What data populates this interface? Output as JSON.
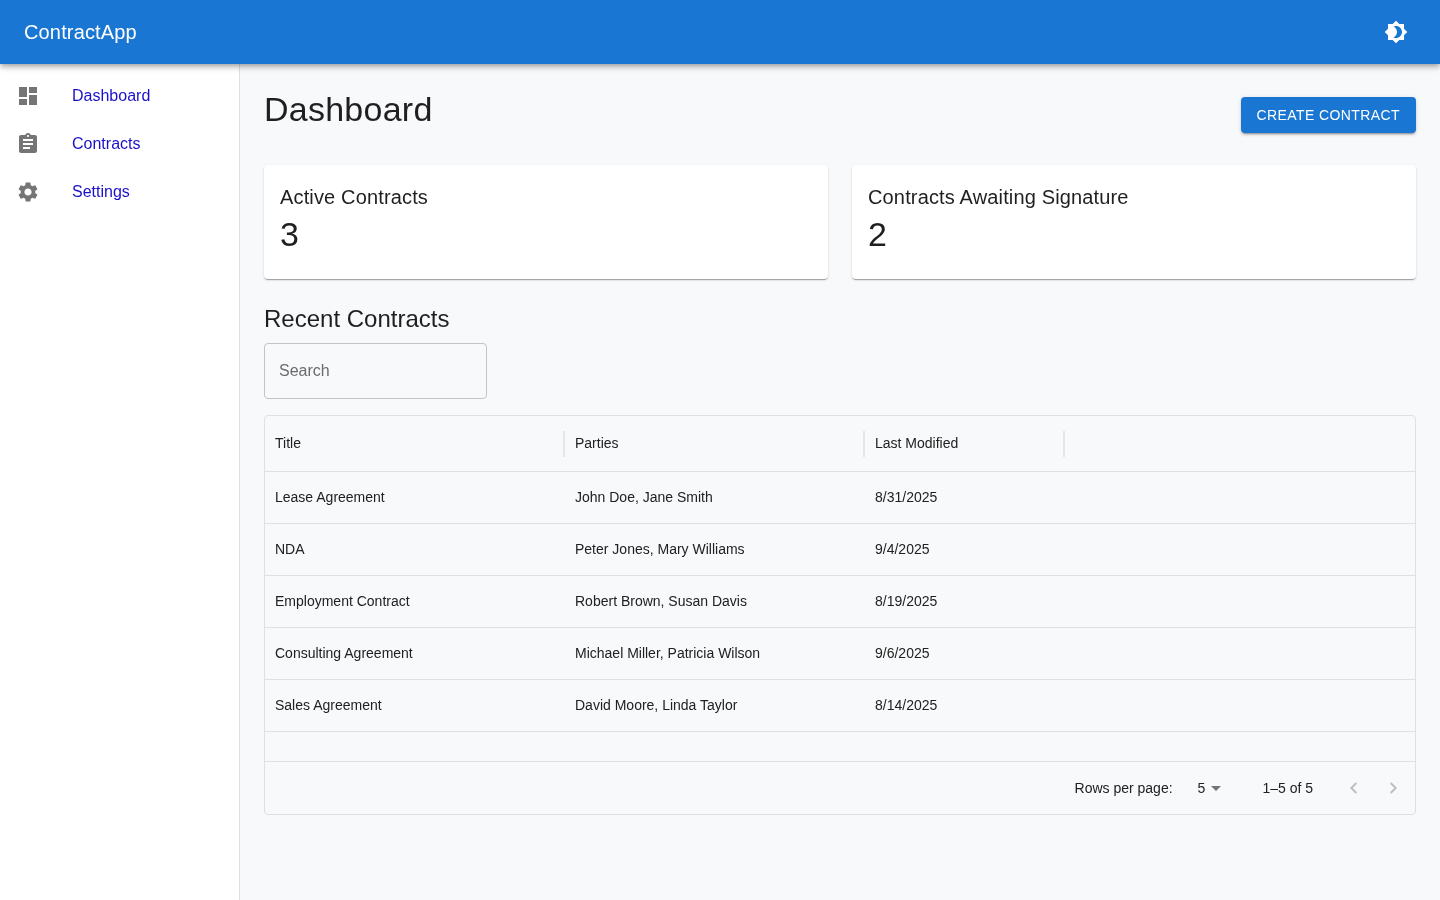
{
  "app_bar": {
    "title": "ContractApp"
  },
  "sidebar": {
    "items": [
      {
        "label": "Dashboard"
      },
      {
        "label": "Contracts"
      },
      {
        "label": "Settings"
      }
    ]
  },
  "page": {
    "title": "Dashboard",
    "primary_button": "CREATE CONTRACT"
  },
  "stat_cards": [
    {
      "label": "Active Contracts",
      "value": "3"
    },
    {
      "label": "Contracts Awaiting Signature",
      "value": "2"
    }
  ],
  "recent_contracts": {
    "title": "Recent Contracts",
    "search": {
      "placeholder": "Search"
    },
    "table": {
      "columns": [
        "Title",
        "Parties",
        "Last Modified"
      ],
      "rows": [
        [
          "Lease Agreement",
          "John Doe, Jane Smith",
          "8/31/2025"
        ],
        [
          "NDA",
          "Peter Jones, Mary Williams",
          "9/4/2025"
        ],
        [
          "Employment Contract",
          "Robert Brown, Susan Davis",
          "8/19/2025"
        ],
        [
          "Consulting Agreement",
          "Michael Miller, Patricia Wilson",
          "9/6/2025"
        ],
        [
          "Sales Agreement",
          "David Moore, Linda Taylor",
          "8/14/2025"
        ]
      ],
      "pagination": {
        "rows_per_page_label": "Rows per page:",
        "rows_per_page": "5",
        "range": "1–5 of 5",
        "previous": {
          "disabled": true
        },
        "next": {
          "disabled": true
        }
      }
    }
  }
}
